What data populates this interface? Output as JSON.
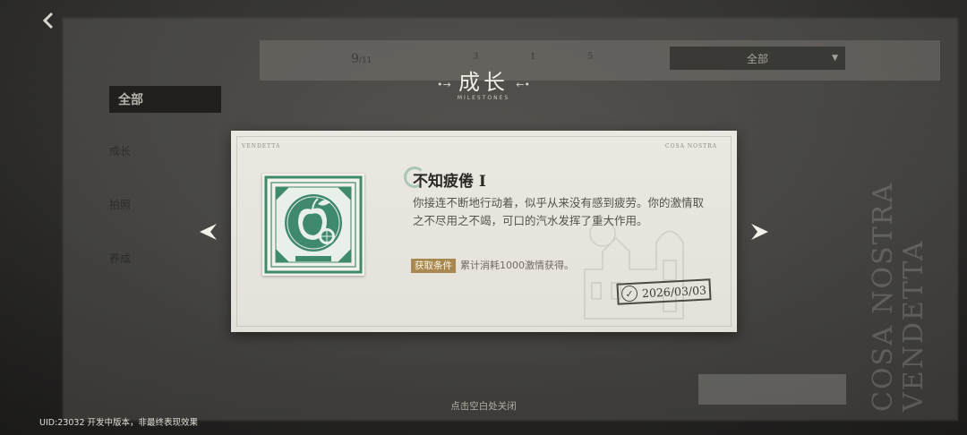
{
  "background": {
    "count": "9",
    "count_total": "/11",
    "stat_1": "3",
    "stat_2": "1",
    "stat_3": "5",
    "filter_label": "全部",
    "sidebar_active": "全部",
    "sidebar_items": [
      "成长",
      "拍照",
      "养成"
    ],
    "side_text": "COSA NOSTRA VENDETTA"
  },
  "header": {
    "title": "成长",
    "subtitle": "MILESTONES"
  },
  "card": {
    "tag_left": "VENDETTA",
    "tag_right": "COSA NOSTRA",
    "achievement_title": "不知疲倦 I",
    "description": "你接连不断地行动着，似乎从来没有感到疲劳。你的激情取之不尽用之不竭，可口的汽水发挥了重大作用。",
    "condition_label": "获取条件",
    "condition_text": "累计消耗1000激情获得。",
    "date": "2026/03/03"
  },
  "footer": {
    "close_hint": "点击空白处关闭",
    "uid_text": "UID:23032   开发中版本，非最终表现效果"
  },
  "colors": {
    "stamp_green": "#3f8a6d",
    "badge_gold": "#a8884e"
  },
  "icons": {
    "back": "back-arrow-icon",
    "prev": "prev-arrow-icon",
    "next": "next-arrow-icon",
    "stamp": "apple-stamp-icon",
    "check": "check-icon"
  }
}
